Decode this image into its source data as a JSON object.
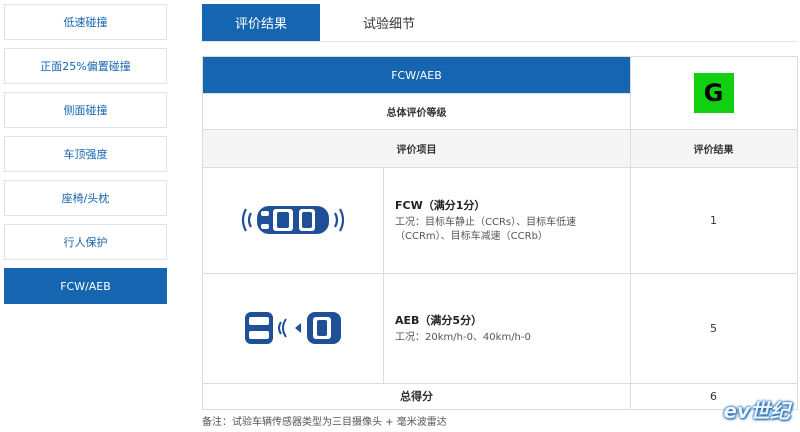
{
  "sidebar": {
    "items": [
      {
        "label": "低速碰撞"
      },
      {
        "label": "正面25%偏置碰撞"
      },
      {
        "label": "侧面碰撞"
      },
      {
        "label": "车顶强度"
      },
      {
        "label": "座椅/头枕"
      },
      {
        "label": "行人保护"
      },
      {
        "label": "FCW/AEB",
        "active": true
      }
    ]
  },
  "tabs": [
    {
      "label": "评价结果",
      "active": true
    },
    {
      "label": "试验细节"
    }
  ],
  "table": {
    "section_title": "FCW/AEB",
    "overall_label": "总体评价等级",
    "overall_grade": "G",
    "grade_color": "#10d010",
    "header_item": "评价项目",
    "header_result": "评价结果",
    "rows": [
      {
        "icon": "car-sensor-waves-icon",
        "title": "FCW（满分1分）",
        "detail": "工况：目标车静止（CCRs）、目标车低速（CCRm）、目标车减速（CCRb）",
        "result": "1"
      },
      {
        "icon": "two-cars-aeb-icon",
        "title": "AEB（满分5分）",
        "detail": "工况：20km/h-0、40km/h-0",
        "result": "5"
      }
    ],
    "total_label": "总得分",
    "total_value": "6"
  },
  "note": "备注：试验车辆传感器类型为三目摄像头 + 毫米波雷达",
  "watermark": "ev世纪",
  "colors": {
    "accent": "#1565b0",
    "grade_green": "#10d010"
  }
}
